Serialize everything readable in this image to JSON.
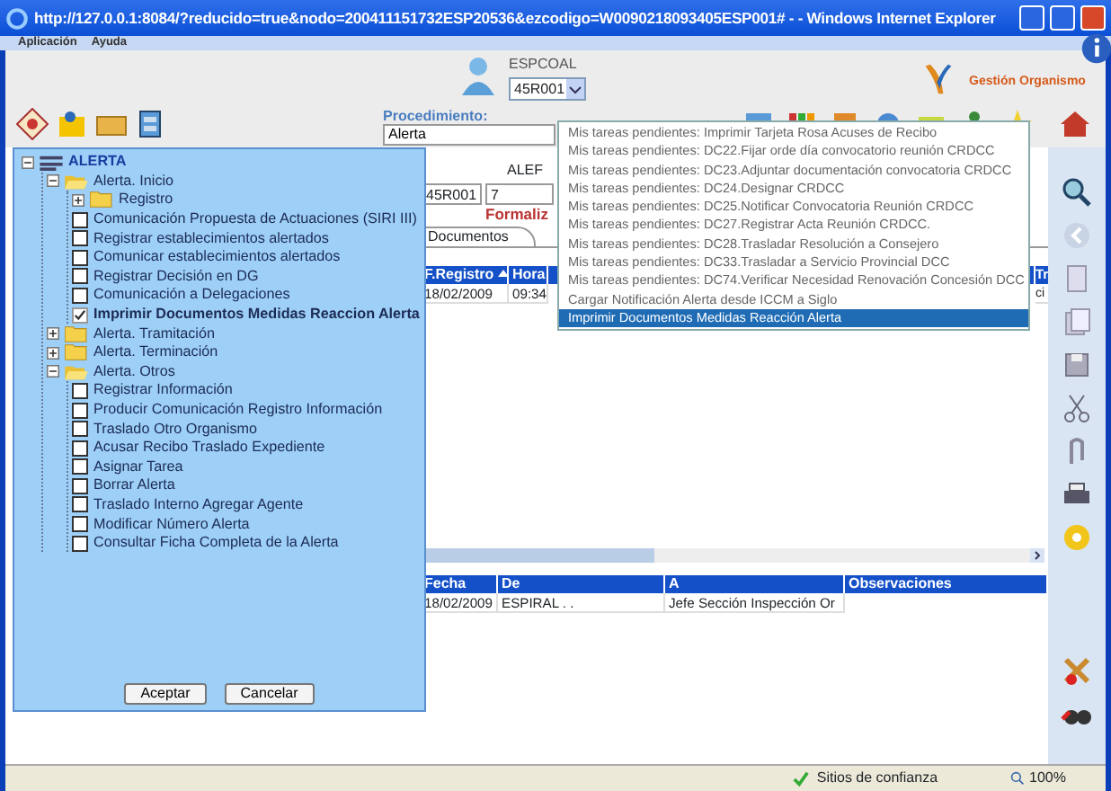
{
  "window": {
    "title": "http://127.0.0.1:8084/?reducido=true&nodo=200411151732ESP20536&ezcodigo=W0090218093405ESP001# - - Windows Internet Explorer"
  },
  "menu": [
    "Aplicación",
    "Ayuda"
  ],
  "header": {
    "user": "ESPCOAL",
    "office": "45R001",
    "brand": "Gestión Organismo"
  },
  "procedure": {
    "label": "Procedimiento:",
    "value": "Alerta"
  },
  "task_menu": [
    {
      "label": "Mis tareas pendientes: Imprimir Tarjeta Rosa Acuses de Recibo",
      "selected": false
    },
    {
      "label": "Mis tareas pendientes: DC22.Fijar orde día convocatorio reunión CRDCC",
      "selected": false
    },
    {
      "label": "Mis tareas pendientes: DC23.Adjuntar documentación convocatoria CRDCC",
      "selected": false
    },
    {
      "label": "Mis tareas pendientes: DC24.Designar CRDCC",
      "selected": false
    },
    {
      "label": "Mis tareas pendientes: DC25.Notificar Convocatoria Reunión CRDCC",
      "selected": false
    },
    {
      "label": "Mis tareas pendientes: DC27.Registrar Acta Reunión CRDCC.",
      "selected": false
    },
    {
      "label": "Mis tareas pendientes: DC28.Trasladar Resolución a Consejero",
      "selected": false
    },
    {
      "label": "Mis tareas pendientes: DC33.Trasladar a Servicio Provincial DCC",
      "selected": false
    },
    {
      "label": "Mis tareas pendientes: DC74.Verificar Necesidad Renovación Concesión DCC",
      "selected": false
    },
    {
      "label": "Cargar Notificación Alerta desde ICCM a Siglo",
      "selected": false
    },
    {
      "label": "Imprimir Documentos Medidas Reacción Alerta",
      "selected": true
    }
  ],
  "record": {
    "title": "ALEF",
    "fields": [
      "45R001",
      "7"
    ],
    "phase": "Formaliz"
  },
  "tabs": [
    {
      "label": "Documentos",
      "selected": true
    }
  ],
  "registry_table": {
    "columns": [
      "F.Registro",
      "Hora",
      "Tr"
    ],
    "rows": [
      [
        "18/02/2009",
        "09:34",
        "ci"
      ]
    ]
  },
  "history_table": {
    "columns": [
      "Fecha",
      "De",
      "A",
      "Observaciones"
    ],
    "rows": [
      [
        "18/02/2009",
        "ESPIRAL . .",
        "Jefe Sección Inspección Or"
      ]
    ]
  },
  "tree": {
    "label": "ALERTA",
    "expanded": true,
    "children": [
      {
        "kind": "folder",
        "label": "Alerta. Inicio",
        "expanded": true,
        "children": [
          {
            "kind": "folder",
            "label": "Registro",
            "expanded": false
          },
          {
            "kind": "task",
            "label": "Comunicación Propuesta de Actuaciones (SIRI III)",
            "checked": false
          },
          {
            "kind": "task",
            "label": "Registrar establecimientos alertados",
            "checked": false
          },
          {
            "kind": "task",
            "label": "Comunicar establecimientos alertados",
            "checked": false
          },
          {
            "kind": "task",
            "label": "Registrar Decisión en DG",
            "checked": false
          },
          {
            "kind": "task",
            "label": "Comunicación a Delegaciones",
            "checked": false
          },
          {
            "kind": "task",
            "label": "Imprimir Documentos Medidas Reaccion Alerta",
            "checked": true
          }
        ]
      },
      {
        "kind": "folder",
        "label": "Alerta. Tramitación",
        "expanded": false
      },
      {
        "kind": "folder",
        "label": "Alerta. Terminación",
        "expanded": false
      },
      {
        "kind": "folder",
        "label": "Alerta. Otros",
        "expanded": true,
        "children": [
          {
            "kind": "task",
            "label": "Registrar Información",
            "checked": false
          },
          {
            "kind": "task",
            "label": "Producir Comunicación Registro Información",
            "checked": false
          },
          {
            "kind": "task",
            "label": "Traslado Otro Organismo",
            "checked": false
          },
          {
            "kind": "task",
            "label": "Acusar Recibo Traslado Expediente",
            "checked": false
          },
          {
            "kind": "task",
            "label": "Asignar Tarea",
            "checked": false
          },
          {
            "kind": "task",
            "label": "Borrar Alerta",
            "checked": false
          },
          {
            "kind": "task",
            "label": "Traslado Interno Agregar Agente",
            "checked": false
          },
          {
            "kind": "task",
            "label": "Modificar Número Alerta",
            "checked": false
          },
          {
            "kind": "task",
            "label": "Consultar Ficha Completa de la Alerta",
            "checked": false
          }
        ]
      }
    ]
  },
  "buttons": [
    "Aceptar",
    "Cancelar"
  ],
  "status_bar": {
    "zone": "Sitios de confianza",
    "zoom": "100%"
  }
}
